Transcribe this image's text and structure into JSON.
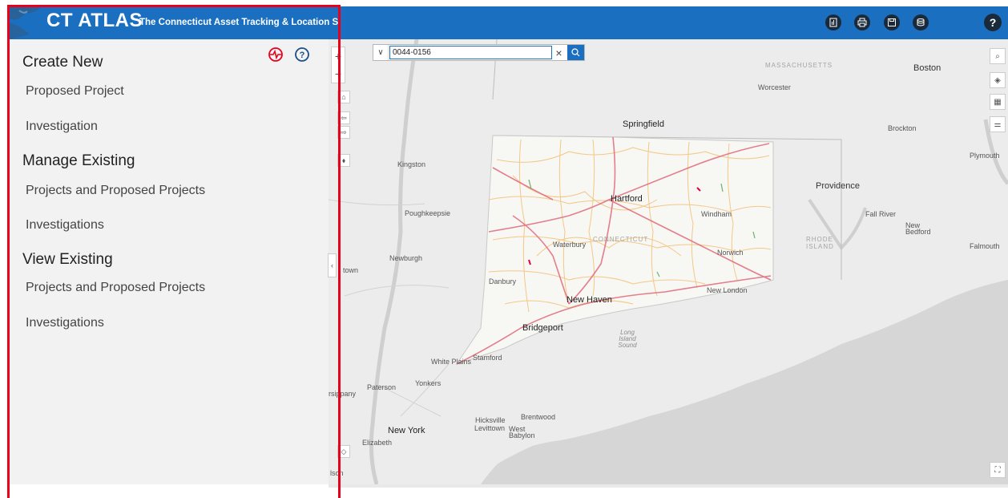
{
  "header": {
    "title": "CT ATLAS",
    "subtitle": "The Connecticut Asset Tracking & Location System",
    "buttons": [
      {
        "name": "report-icon"
      },
      {
        "name": "print-icon"
      },
      {
        "name": "save-icon"
      },
      {
        "name": "database-icon"
      }
    ],
    "help_label": "?"
  },
  "sidebar": {
    "sections": [
      {
        "heading": "Create New",
        "items": [
          "Proposed Project",
          "Investigation"
        ]
      },
      {
        "heading": "Manage Existing",
        "items": [
          "Projects and Proposed Projects",
          "Investigations"
        ]
      },
      {
        "heading": "View Existing",
        "items": [
          "Projects and Proposed Projects",
          "Investigations"
        ]
      }
    ],
    "icons": [
      "activity-icon",
      "help-circle-icon"
    ]
  },
  "search": {
    "value": "0044-0156",
    "placeholder": ""
  },
  "map": {
    "zoom_in": "+",
    "zoom_out": "−",
    "labels": {
      "boston": "Boston",
      "massachusetts": "MASSACHUSETTS",
      "worcester": "Worcester",
      "springfield": "Springfield",
      "brockton": "Brockton",
      "plymouth": "Plymouth",
      "kingston": "Kingston",
      "hartford": "Hartford",
      "providence": "Providence",
      "poughkeepsie": "Poughkeepsie",
      "windham": "Windham",
      "fall_river": "Fall River",
      "new_bedford": "New Bedford",
      "rhode_island": "RHODE ISLAND",
      "falmouth": "Falmouth",
      "waterbury": "Waterbury",
      "connecticut": "CONNECTICUT",
      "newburgh": "Newburgh",
      "norwich": "Norwich",
      "danbury": "Danbury",
      "town": "town",
      "new_london": "New London",
      "new_haven": "New Haven",
      "bridgeport": "Bridgeport",
      "long_island_sound": "Long Island Sound",
      "stamford": "Stamford",
      "white_plains": "White Plains",
      "yonkers": "Yonkers",
      "paterson": "Paterson",
      "rsippany": "rsippany",
      "brentwood": "Brentwood",
      "hicksville": "Hicksville",
      "levittown": "Levittown",
      "west_babylon": "West Babylon",
      "new_york": "New York",
      "elizabeth": "Elizabeth",
      "lson": "lson"
    }
  },
  "colors": {
    "header_bg": "#1a6fc1",
    "sidebar_bg": "#f2f2f2",
    "accent_red": "#e8001c",
    "road_primary": "#e06a7a",
    "road_secondary": "#f5c27c"
  }
}
